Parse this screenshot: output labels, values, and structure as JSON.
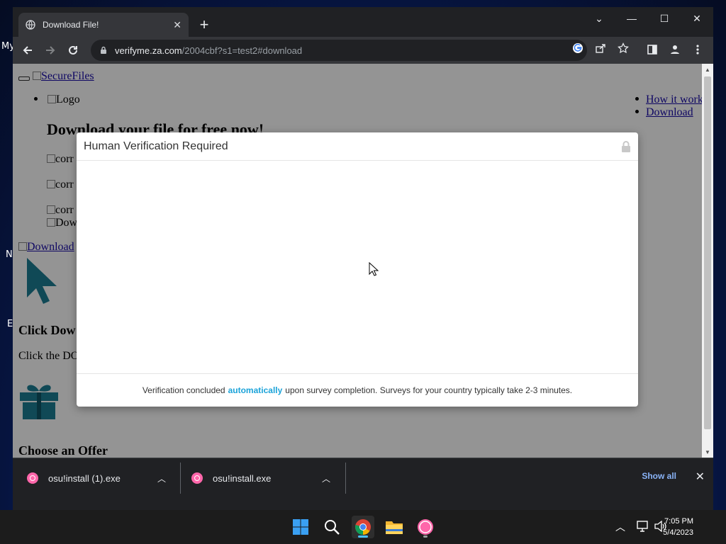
{
  "desktop": {
    "fragments": [
      "My",
      "N",
      "E"
    ]
  },
  "browser": {
    "tab_title": "Download File!",
    "tab_close": "✕",
    "new_tab": "+",
    "window_controls": {
      "dropdown": "⌄",
      "minimize": "—",
      "maximize": "☐",
      "close": "✕"
    },
    "url_host": "verifyme.za.com",
    "url_path": "/2004cbf?s1=test2#download"
  },
  "page": {
    "securefiles_link": "SecureFiles",
    "logo_alt": "Logo",
    "nav_links": [
      "How it work",
      "Download"
    ],
    "heading": "Download your file for free now!",
    "corr_images": [
      "corr",
      "corr",
      "corr"
    ],
    "dow_image": "Dow",
    "download_link": "Download",
    "click_heading": "Click Dow",
    "click_text": "Click the DO",
    "choose_heading": "Choose an Offer"
  },
  "modal": {
    "title": "Human Verification Required",
    "footer_before": "Verification concluded",
    "footer_highlight": "automatically",
    "footer_after": "upon survey completion. Surveys for your country typically take 2-3 minutes."
  },
  "downloads": {
    "items": [
      {
        "name": "osu!install (1).exe"
      },
      {
        "name": "osu!install.exe"
      }
    ],
    "show_all": "Show all",
    "close": "✕"
  },
  "taskbar": {
    "clock_time": "7:05 PM",
    "clock_date": "5/4/2023"
  },
  "colors": {
    "accent_link": "#1ba3d9",
    "chrome_dark": "#202124",
    "osu_pink": "#ff66aa",
    "cursor_teal": "#1d7f95"
  }
}
